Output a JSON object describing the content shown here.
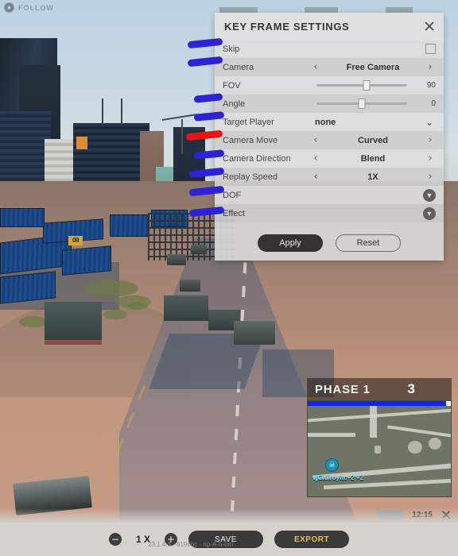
{
  "hud": {
    "follow_label": "FOLLOW",
    "follow_icon": "person-follow-icon"
  },
  "dialog": {
    "title": "KEY FRAME SETTINGS",
    "close_icon": "close-icon",
    "rows": [
      {
        "label": "Skip",
        "type": "checkbox",
        "checked": false
      },
      {
        "label": "Camera",
        "type": "stepper",
        "value": "Free Camera"
      },
      {
        "label": "FOV",
        "type": "slider",
        "value": "90",
        "percent": 55
      },
      {
        "label": "Angle",
        "type": "slider",
        "value": "0",
        "percent": 50
      },
      {
        "label": "Target Player",
        "type": "dropdown",
        "value": "none"
      },
      {
        "label": "Camera Move",
        "type": "stepper",
        "value": "Curved"
      },
      {
        "label": "Camera Direction",
        "type": "stepper",
        "value": "Blend"
      },
      {
        "label": "Replay Speed",
        "type": "stepper",
        "value": "1X"
      },
      {
        "label": "DOF",
        "type": "expander"
      },
      {
        "label": "Effect",
        "type": "expander"
      }
    ],
    "arrow_left": "‹",
    "arrow_right": "›",
    "chevron_down": "⌄",
    "apply_label": "Apply",
    "reset_label": "Reset"
  },
  "phase": {
    "label": "PHASE 1",
    "count": "3"
  },
  "minimap": {
    "player_name": "vjGkilroyitc+2 +2",
    "player_icon": "skull-marker-icon"
  },
  "system": {
    "clock": "12:15",
    "close_icon": "close-icon"
  },
  "toolbar": {
    "decrement_icon": "minus-circle-icon",
    "increment_icon": "plus-circle-icon",
    "zoom_value": "1 X",
    "save_label": "SAVE",
    "export_label": "EXPORT",
    "watermark": "23.1.4.3 · 819ebc · np-A-h-om"
  },
  "scene": {
    "building_marker": "09"
  },
  "colors": {
    "annotation_blue": "#2d22d6",
    "annotation_red": "#e81414",
    "export_gold": "#e8c335",
    "minimap_bar_blue": "#1224f0"
  }
}
